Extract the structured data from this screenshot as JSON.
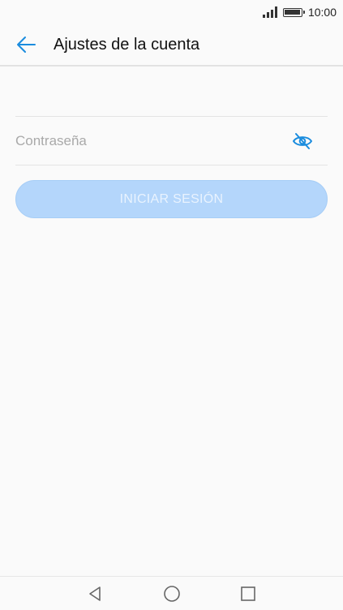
{
  "status_bar": {
    "time": "10:00",
    "icons": [
      "signal-icon",
      "battery-icon"
    ]
  },
  "app_bar": {
    "title": "Ajustes de la cuenta",
    "back_icon": "back-arrow-icon"
  },
  "form": {
    "password_placeholder": "Contraseña",
    "password_value": "",
    "visibility_icon": "eye-off-icon",
    "login_label": "INICIAR SESIÓN"
  },
  "nav_bar": {
    "icons": [
      "back-triangle-icon",
      "home-circle-icon",
      "recents-square-icon"
    ]
  },
  "colors": {
    "accent": "#1a8cde",
    "button_disabled": "#b4d6fb",
    "background": "#fafafa"
  }
}
